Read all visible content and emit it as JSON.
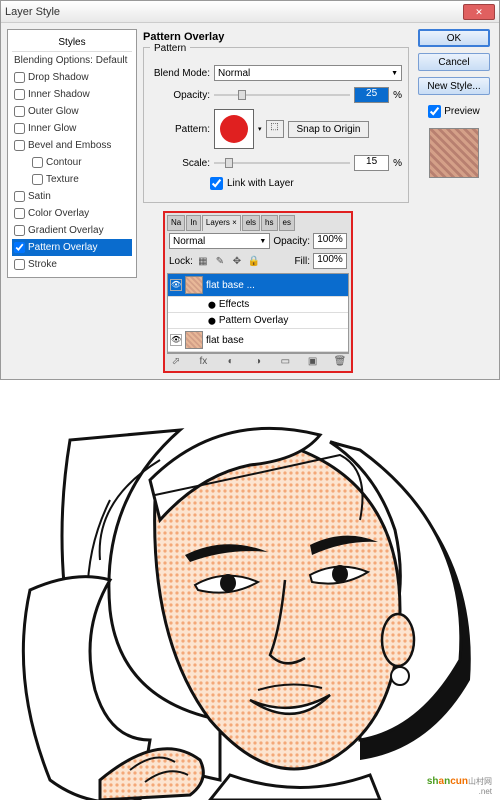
{
  "dialog": {
    "title": "Layer Style",
    "styles_header": "Styles",
    "blending_default": "Blending Options: Default",
    "styles": [
      {
        "label": "Drop Shadow",
        "checked": false
      },
      {
        "label": "Inner Shadow",
        "checked": false
      },
      {
        "label": "Outer Glow",
        "checked": false
      },
      {
        "label": "Inner Glow",
        "checked": false
      },
      {
        "label": "Bevel and Emboss",
        "checked": false
      },
      {
        "label": "Contour",
        "checked": false,
        "indent": true
      },
      {
        "label": "Texture",
        "checked": false,
        "indent": true
      },
      {
        "label": "Satin",
        "checked": false
      },
      {
        "label": "Color Overlay",
        "checked": false
      },
      {
        "label": "Gradient Overlay",
        "checked": false
      },
      {
        "label": "Pattern Overlay",
        "checked": true,
        "active": true
      },
      {
        "label": "Stroke",
        "checked": false
      }
    ],
    "section_title": "Pattern Overlay",
    "fieldset_legend": "Pattern",
    "blend_mode_label": "Blend Mode:",
    "blend_mode_value": "Normal",
    "opacity_label": "Opacity:",
    "opacity_value": "25",
    "opacity_unit": "%",
    "pattern_label": "Pattern:",
    "snap_label": "Snap to Origin",
    "scale_label": "Scale:",
    "scale_value": "15",
    "scale_unit": "%",
    "link_label": "Link with Layer",
    "buttons": {
      "ok": "OK",
      "cancel": "Cancel",
      "newstyle": "New Style..."
    },
    "preview_label": "Preview"
  },
  "layers": {
    "tabs": [
      "Na",
      "In",
      "Layers ×",
      "els",
      "hs",
      "es"
    ],
    "mode": "Normal",
    "opacity_label": "Opacity:",
    "opacity": "100%",
    "lock_label": "Lock:",
    "fill_label": "Fill:",
    "fill": "100%",
    "items": [
      {
        "name": "flat base ...",
        "selected": true
      },
      {
        "name": "Effects",
        "sub": true
      },
      {
        "name": "Pattern Overlay",
        "sub": true
      },
      {
        "name": "flat base"
      }
    ]
  },
  "watermark": {
    "p1": "sh",
    "p2": "a",
    "p3": "n",
    "p4": "cun",
    "suffix": ".net",
    "tag": "山村网"
  }
}
